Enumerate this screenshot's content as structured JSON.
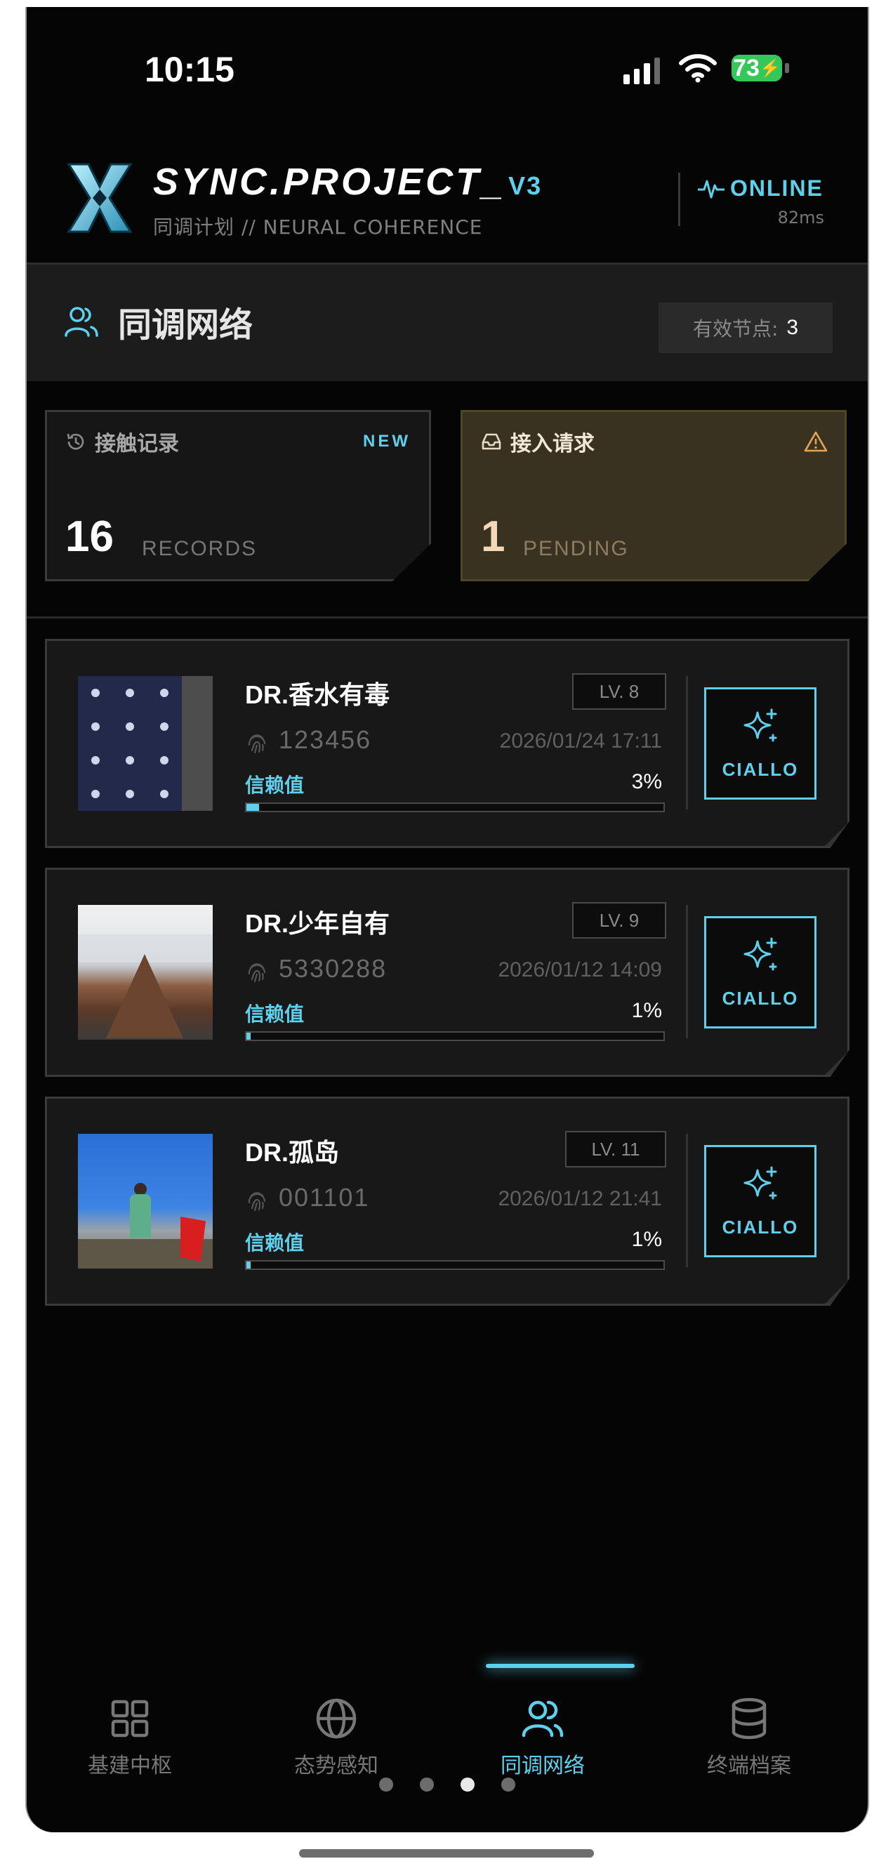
{
  "status_bar": {
    "time": "10:15",
    "battery": "73"
  },
  "header": {
    "title": "SYNC.PROJECT_",
    "version": "V3",
    "subtitle": "同调计划 // NEURAL COHERENCE",
    "status": "ONLINE",
    "latency": "82ms"
  },
  "section": {
    "title": "同调网络",
    "node_label": "有效节点:",
    "node_count": "3"
  },
  "stats": {
    "records": {
      "title": "接触记录",
      "flag": "NEW",
      "count": "16",
      "unit": "RECORDS"
    },
    "requests": {
      "title": "接入请求",
      "count": "1",
      "unit": "PENDING"
    }
  },
  "users": [
    {
      "name": "DR.香水有毒",
      "level": "LV. 8",
      "id": "123456",
      "time": "2026/01/24 17:11",
      "trust_label": "信赖值",
      "trust": "3%",
      "trust_fraction": 0.03,
      "action": "CIALLO",
      "avatar": "app-screenshot"
    },
    {
      "name": "DR.少年自有",
      "level": "LV. 9",
      "id": "5330288",
      "time": "2026/01/12 14:09",
      "trust_label": "信赖值",
      "trust": "1%",
      "trust_fraction": 0.01,
      "action": "CIALLO",
      "avatar": "mountain-photo"
    },
    {
      "name": "DR.孤岛",
      "level": "LV. 11",
      "id": "001101",
      "time": "2026/01/12 21:41",
      "trust_label": "信赖值",
      "trust": "1%",
      "trust_fraction": 0.01,
      "action": "CIALLO",
      "avatar": "summit-photo"
    }
  ],
  "nav": {
    "items": [
      {
        "label": "基建中枢",
        "icon": "grid-icon"
      },
      {
        "label": "态势感知",
        "icon": "globe-icon"
      },
      {
        "label": "同调网络",
        "icon": "users-icon",
        "active": true
      },
      {
        "label": "终端档案",
        "icon": "database-icon"
      }
    ],
    "page_dots": 4,
    "active_dot": 3
  },
  "colors": {
    "accent": "#5fd0ec",
    "background": "#050505",
    "card": "#181818",
    "pending": "#3a3220",
    "battery": "#35c759"
  }
}
